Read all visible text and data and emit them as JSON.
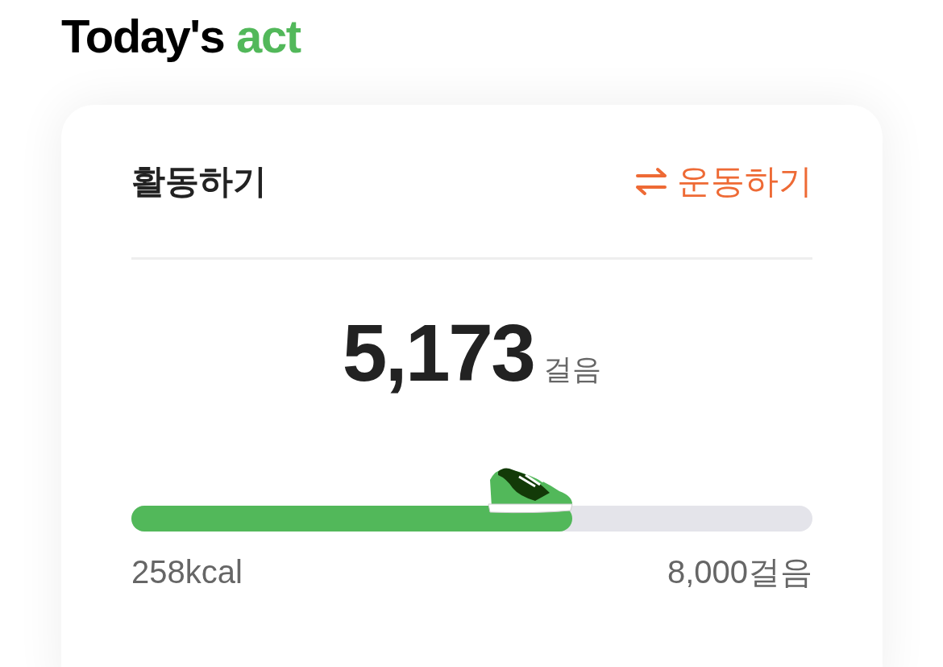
{
  "heading": {
    "text": "Today's",
    "accent": "act"
  },
  "card": {
    "title": "활동하기",
    "switch_link": "운동하기",
    "steps": "5,173",
    "steps_unit": "걸음",
    "progress": {
      "level": 0.647
    },
    "calories": "258kcal",
    "goal": "8,000걸음"
  }
}
